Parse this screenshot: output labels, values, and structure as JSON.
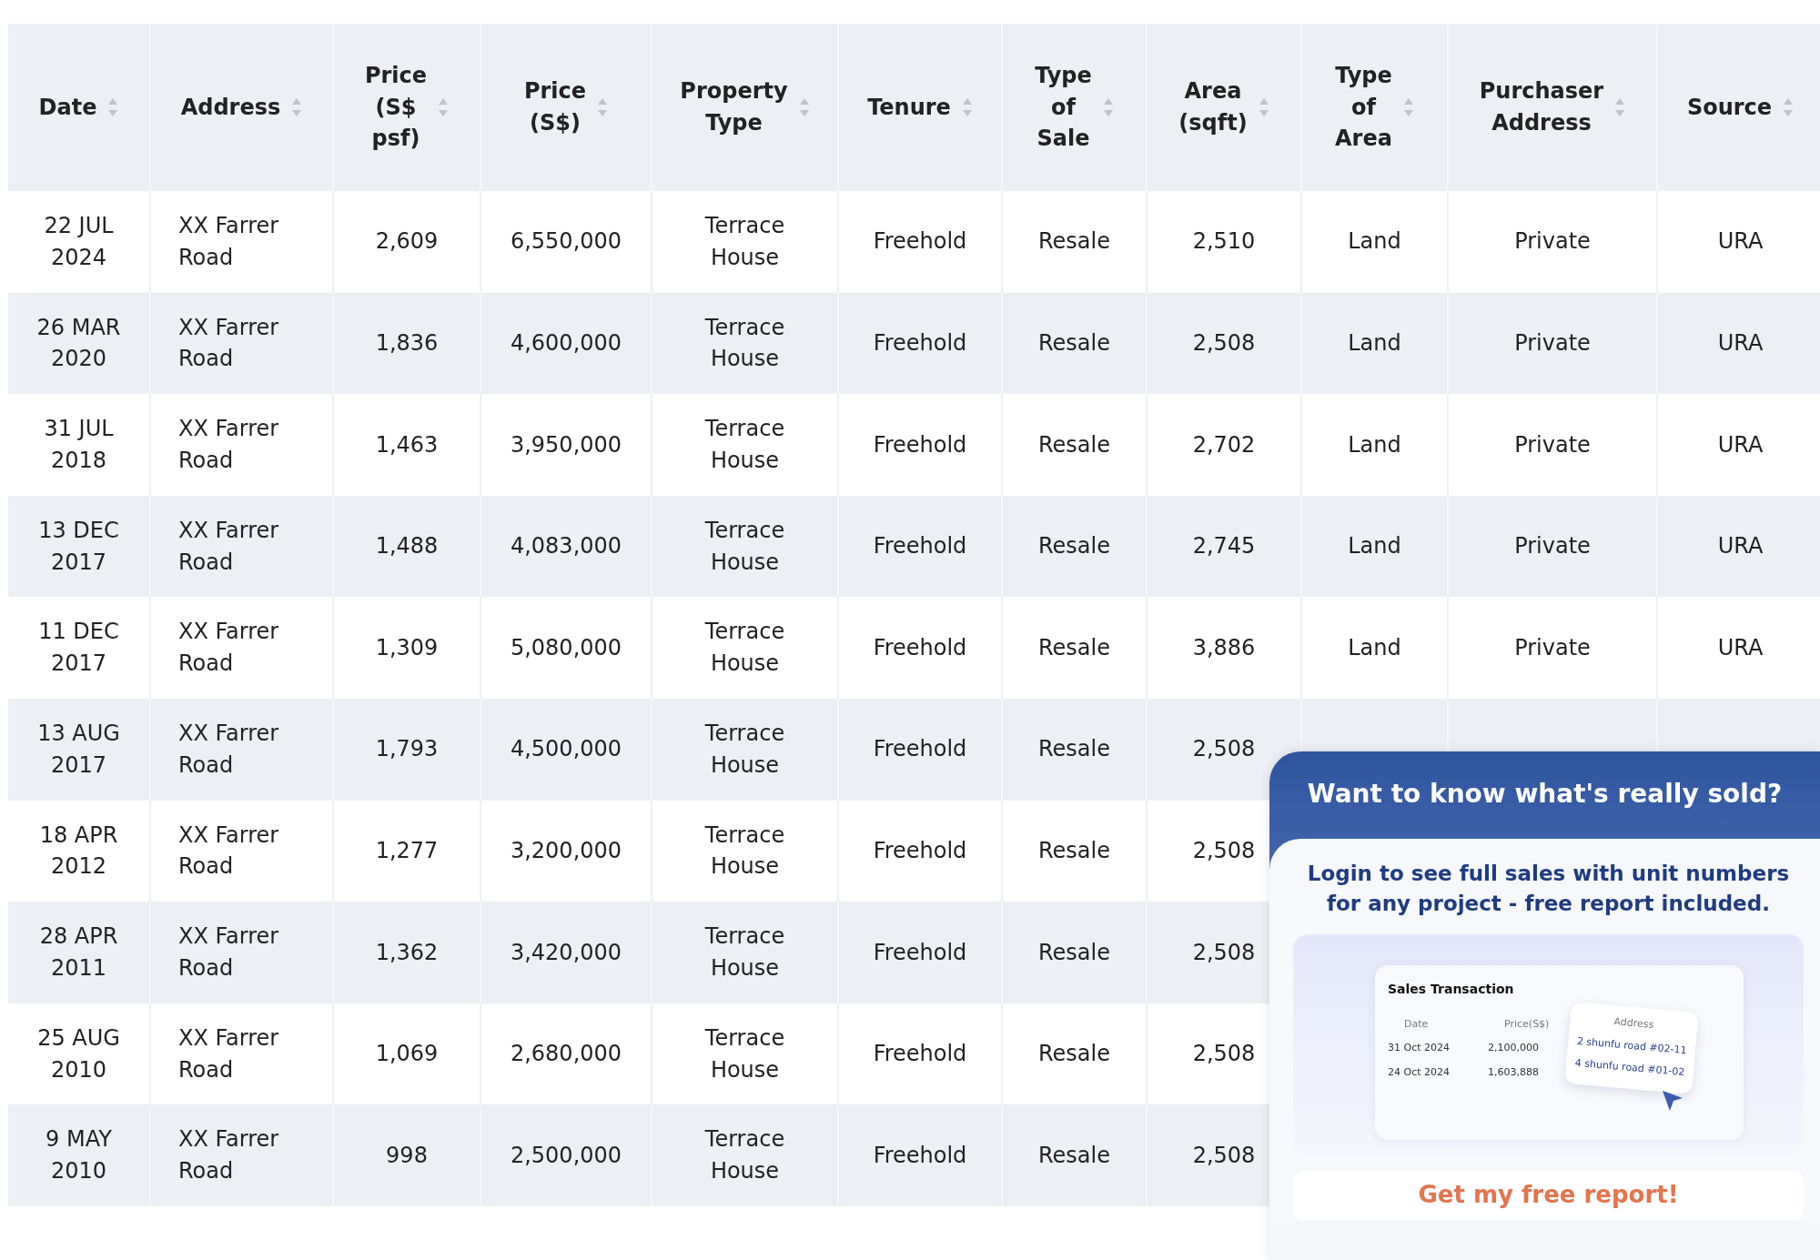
{
  "table": {
    "columns": [
      "Date",
      "Address",
      "Price (S$ psf)",
      "Price (S$)",
      "Property Type",
      "Tenure",
      "Type of Sale",
      "Area (sqft)",
      "Type of Area",
      "Purchaser Address",
      "Source"
    ],
    "rows": [
      [
        "22 JUL 2024",
        "XX Farrer Road",
        "2,609",
        "6,550,000",
        "Terrace House",
        "Freehold",
        "Resale",
        "2,510",
        "Land",
        "Private",
        "URA"
      ],
      [
        "26 MAR 2020",
        "XX Farrer Road",
        "1,836",
        "4,600,000",
        "Terrace House",
        "Freehold",
        "Resale",
        "2,508",
        "Land",
        "Private",
        "URA"
      ],
      [
        "31 JUL 2018",
        "XX Farrer Road",
        "1,463",
        "3,950,000",
        "Terrace House",
        "Freehold",
        "Resale",
        "2,702",
        "Land",
        "Private",
        "URA"
      ],
      [
        "13 DEC 2017",
        "XX Farrer Road",
        "1,488",
        "4,083,000",
        "Terrace House",
        "Freehold",
        "Resale",
        "2,745",
        "Land",
        "Private",
        "URA"
      ],
      [
        "11 DEC 2017",
        "XX Farrer Road",
        "1,309",
        "5,080,000",
        "Terrace House",
        "Freehold",
        "Resale",
        "3,886",
        "Land",
        "Private",
        "URA"
      ],
      [
        "13 AUG 2017",
        "XX Farrer Road",
        "1,793",
        "4,500,000",
        "Terrace House",
        "Freehold",
        "Resale",
        "2,508"
      ],
      [
        "18 APR 2012",
        "XX Farrer Road",
        "1,277",
        "3,200,000",
        "Terrace House",
        "Freehold",
        "Resale",
        "2,508"
      ],
      [
        "28 APR 2011",
        "XX Farrer Road",
        "1,362",
        "3,420,000",
        "Terrace House",
        "Freehold",
        "Resale",
        "2,508"
      ],
      [
        "25 AUG 2010",
        "XX Farrer Road",
        "1,069",
        "2,680,000",
        "Terrace House",
        "Freehold",
        "Resale",
        "2,508"
      ],
      [
        "9 MAY 2010",
        "XX Farrer Road",
        "998",
        "2,500,000",
        "Terrace House",
        "Freehold",
        "Resale",
        "2,508"
      ]
    ]
  },
  "popup": {
    "title": "Want to know what's really sold?",
    "message": "Login to see full sales with unit numbers for any project - free report included.",
    "preview": {
      "title": "Sales Transaction",
      "columns": [
        "Date",
        "Price(S$)",
        "Address"
      ],
      "rows": [
        [
          "31 Oct 2024",
          "2,100,000",
          "2 shunfu road #02-11"
        ],
        [
          "24 Oct 2024",
          "1,603,888",
          "4 shunfu road #01-02"
        ]
      ]
    },
    "button": "Get my free report!"
  }
}
